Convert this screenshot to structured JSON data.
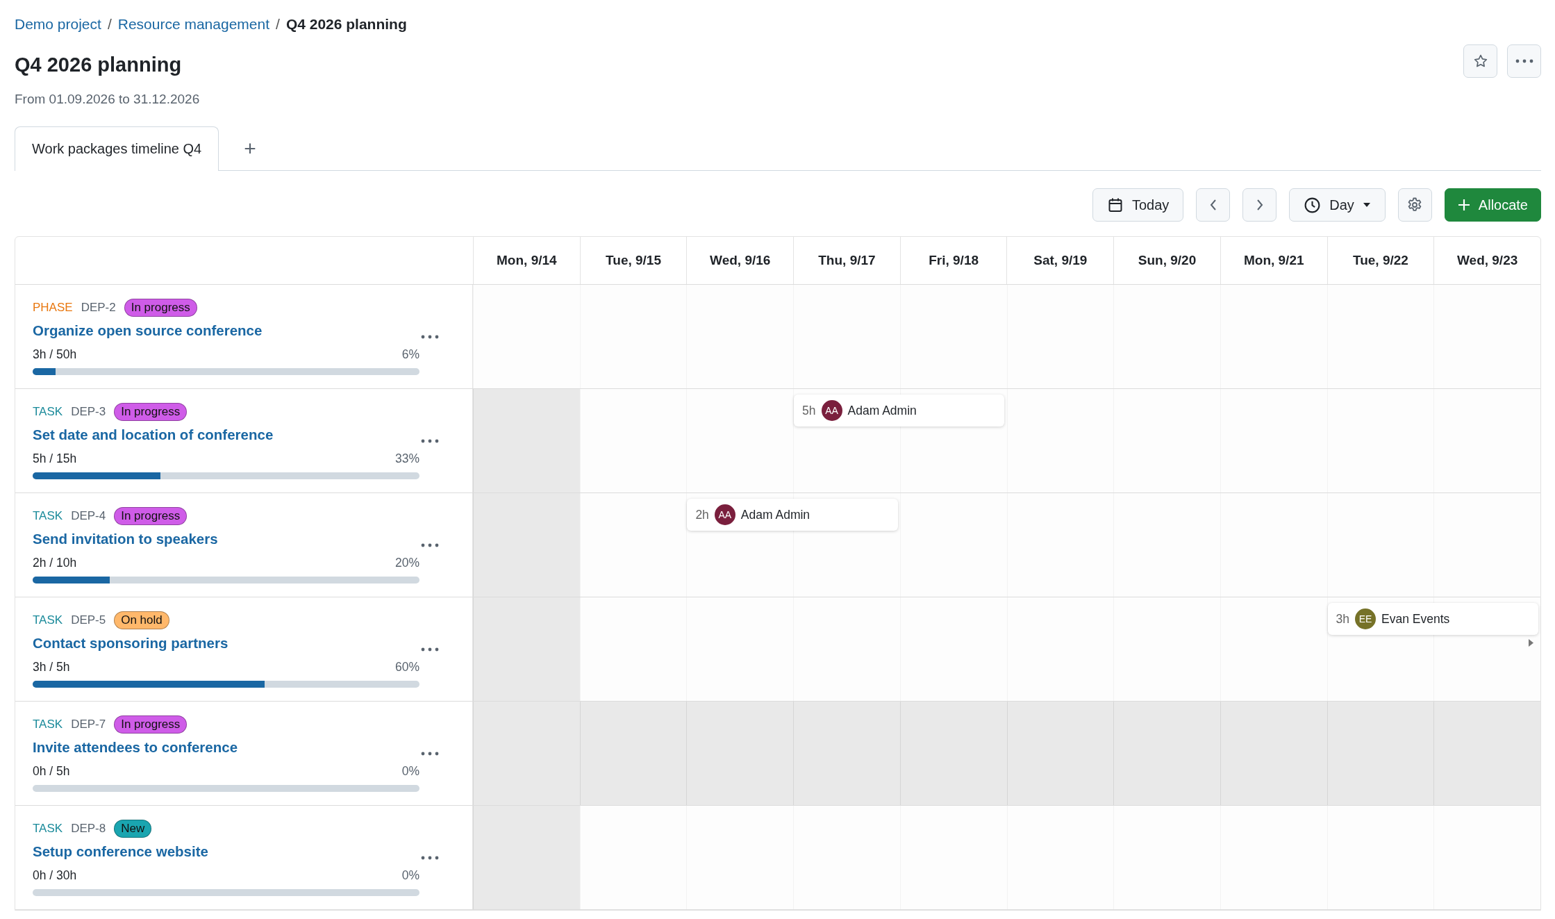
{
  "breadcrumb": [
    {
      "label": "Demo project",
      "kind": "link"
    },
    {
      "label": "Resource management",
      "kind": "link"
    },
    {
      "label": "Q4 2026 planning",
      "kind": "current"
    }
  ],
  "separator": "/",
  "title": "Q4 2026 planning",
  "subtitle": "From 01.09.2026 to 31.12.2026",
  "tabs": [
    {
      "label": "Work packages timeline Q4",
      "selected": true
    }
  ],
  "add_tab": "+",
  "toolbar": {
    "today": "Today",
    "view": "Day",
    "allocate": "Allocate"
  },
  "days": [
    "Mon, 9/14",
    "Tue, 9/15",
    "Wed, 9/16",
    "Thu, 9/17",
    "Fri, 9/18",
    "Sat, 9/19",
    "Sun, 9/20",
    "Mon, 9/21",
    "Tue, 9/22",
    "Wed, 9/23"
  ],
  "rows": [
    {
      "kind": "phase",
      "type": "PHASE",
      "id": "DEP-2",
      "status": {
        "label": "In progress",
        "color": "#cf5ce8"
      },
      "title": "Organize open source conference",
      "hours": "3h / 50h",
      "percent": "6%",
      "level": 0.06,
      "overflow": false,
      "cells": [
        {
          "shaded": false
        },
        {
          "shaded": false
        },
        {
          "shaded": false
        },
        {
          "shaded": false
        },
        {
          "shaded": false
        },
        {
          "shaded": false
        },
        {
          "shaded": false
        },
        {
          "shaded": false
        },
        {
          "shaded": false
        },
        {
          "shaded": false
        }
      ]
    },
    {
      "kind": "task",
      "type": "TASK",
      "id": "DEP-3",
      "status": {
        "label": "In progress",
        "color": "#cf5ce8"
      },
      "title": "Set date and location of conference",
      "hours": "5h / 15h",
      "percent": "33%",
      "level": 0.33,
      "overflow": false,
      "cells": [
        {
          "shaded": true
        },
        {
          "shaded": false
        },
        {
          "shaded": false
        },
        {
          "shaded": false,
          "allocation": {
            "hours": "5h",
            "initials": "AA",
            "name": "Adam Admin",
            "color": "#7a1f3d"
          }
        },
        {
          "shaded": false
        },
        {
          "shaded": false
        },
        {
          "shaded": false
        },
        {
          "shaded": false
        },
        {
          "shaded": false
        },
        {
          "shaded": false
        }
      ]
    },
    {
      "kind": "task",
      "type": "TASK",
      "id": "DEP-4",
      "status": {
        "label": "In progress",
        "color": "#cf5ce8"
      },
      "title": "Send invitation to speakers",
      "hours": "2h / 10h",
      "percent": "20%",
      "level": 0.2,
      "overflow": false,
      "cells": [
        {
          "shaded": true
        },
        {
          "shaded": false
        },
        {
          "shaded": false,
          "allocation": {
            "hours": "2h",
            "initials": "AA",
            "name": "Adam Admin",
            "color": "#7a1f3d"
          }
        },
        {
          "shaded": false
        },
        {
          "shaded": false
        },
        {
          "shaded": false
        },
        {
          "shaded": false
        },
        {
          "shaded": false
        },
        {
          "shaded": false
        },
        {
          "shaded": false
        }
      ]
    },
    {
      "kind": "task",
      "type": "TASK",
      "id": "DEP-5",
      "status": {
        "label": "On hold",
        "color": "#ffb86b"
      },
      "title": "Contact sponsoring partners",
      "hours": "3h / 5h",
      "percent": "60%",
      "level": 0.6,
      "overflow": true,
      "cells": [
        {
          "shaded": true
        },
        {
          "shaded": false
        },
        {
          "shaded": false
        },
        {
          "shaded": false
        },
        {
          "shaded": false
        },
        {
          "shaded": false
        },
        {
          "shaded": false
        },
        {
          "shaded": false
        },
        {
          "shaded": false,
          "allocation": {
            "hours": "3h",
            "initials": "EE",
            "name": "Evan Events",
            "color": "#767228"
          }
        },
        {
          "shaded": false
        }
      ]
    },
    {
      "kind": "task",
      "type": "TASK",
      "id": "DEP-7",
      "status": {
        "label": "In progress",
        "color": "#cf5ce8"
      },
      "title": "Invite attendees to conference",
      "hours": "0h / 5h",
      "percent": "0%",
      "level": 0,
      "overflow": false,
      "cells": [
        {
          "shaded": true
        },
        {
          "shaded": true
        },
        {
          "shaded": true
        },
        {
          "shaded": true
        },
        {
          "shaded": true
        },
        {
          "shaded": true
        },
        {
          "shaded": true
        },
        {
          "shaded": true
        },
        {
          "shaded": true
        },
        {
          "shaded": true
        }
      ]
    },
    {
      "kind": "task",
      "type": "TASK",
      "id": "DEP-8",
      "status": {
        "label": "New",
        "color": "#1aa5b0"
      },
      "title": "Setup conference website",
      "hours": "0h / 30h",
      "percent": "0%",
      "level": 0,
      "overflow": false,
      "cells": [
        {
          "shaded": true
        },
        {
          "shaded": false
        },
        {
          "shaded": false
        },
        {
          "shaded": false
        },
        {
          "shaded": false
        },
        {
          "shaded": false
        },
        {
          "shaded": false
        },
        {
          "shaded": false
        },
        {
          "shaded": false
        },
        {
          "shaded": false
        }
      ]
    }
  ]
}
